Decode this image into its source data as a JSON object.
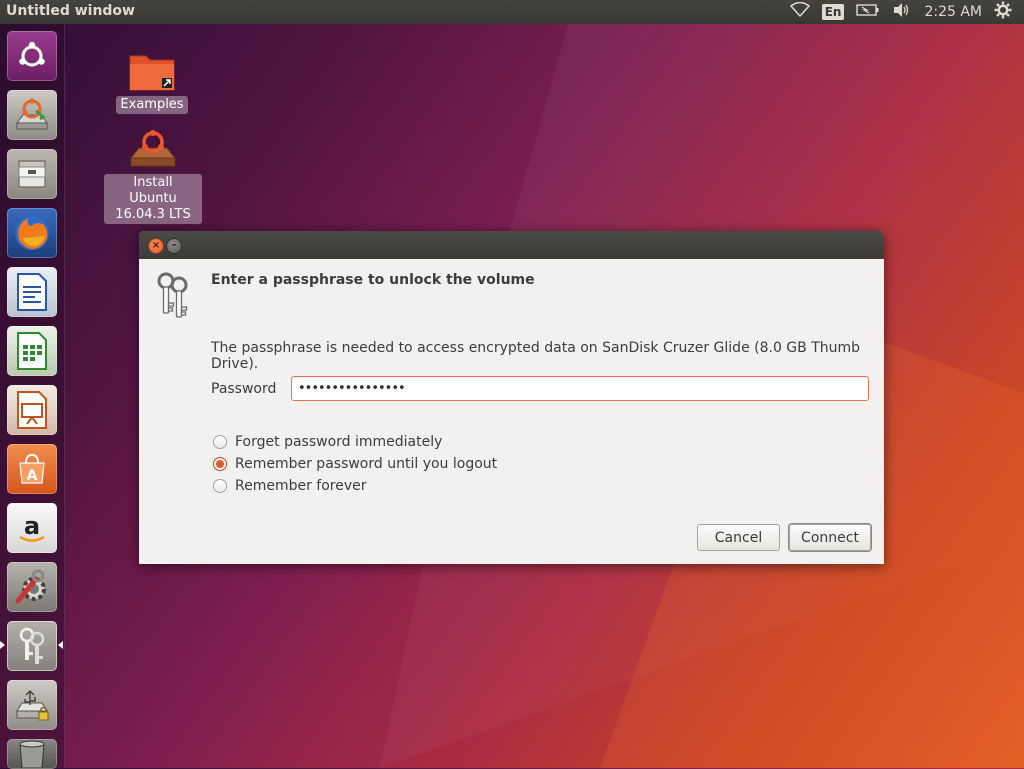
{
  "top_panel": {
    "window_title": "Untitled window",
    "keyboard_layout": "En",
    "clock": "2:25 AM",
    "icons": [
      "wifi-icon",
      "keyboard-layout-indicator",
      "battery-icon",
      "volume-icon",
      "gear-icon"
    ]
  },
  "launcher": {
    "items": [
      {
        "name": "ubuntu-dash-icon"
      },
      {
        "name": "install-ubuntu-icon"
      },
      {
        "name": "files-icon"
      },
      {
        "name": "firefox-icon"
      },
      {
        "name": "libreoffice-writer-icon"
      },
      {
        "name": "libreoffice-calc-icon"
      },
      {
        "name": "libreoffice-impress-icon"
      },
      {
        "name": "software-center-icon"
      },
      {
        "name": "amazon-icon"
      },
      {
        "name": "system-settings-icon"
      },
      {
        "name": "keys-passwords-icon"
      },
      {
        "name": "usb-drive-icon"
      },
      {
        "name": "trash-icon"
      }
    ]
  },
  "desktop": {
    "icons": [
      {
        "label": "Examples"
      },
      {
        "label": "Install Ubuntu 16.04.3 LTS",
        "label_line1": "Install Ubuntu",
        "label_line2": "16.04.3 LTS"
      }
    ]
  },
  "dialog": {
    "heading": "Enter a passphrase to unlock the volume",
    "description": "The passphrase is needed to access encrypted data on SanDisk Cruzer Glide (8.0 GB Thumb Drive).",
    "password_label": "Password",
    "password_value": "••••••••••••••••",
    "options": [
      {
        "label": "Forget password immediately",
        "selected": false
      },
      {
        "label": "Remember password until you logout",
        "selected": true
      },
      {
        "label": "Remember forever",
        "selected": false
      }
    ],
    "cancel_label": "Cancel",
    "connect_label": "Connect"
  },
  "colors": {
    "accent": "#e05a29",
    "panel": "#3c3b37"
  }
}
